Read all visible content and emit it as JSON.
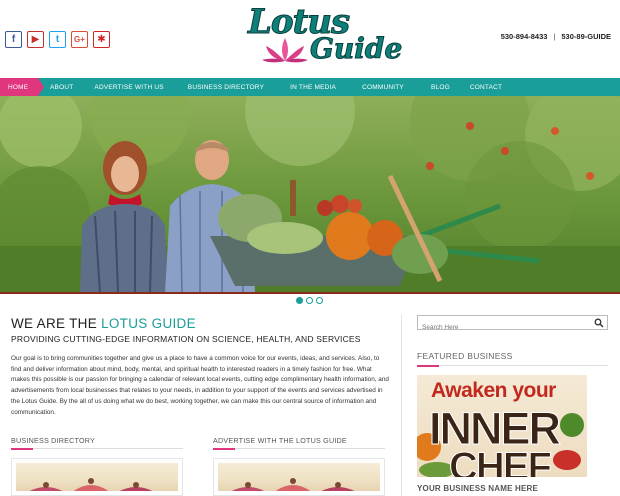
{
  "header": {
    "social": [
      {
        "name": "facebook",
        "glyph": "f"
      },
      {
        "name": "youtube",
        "glyph": "▶"
      },
      {
        "name": "twitter",
        "glyph": "t"
      },
      {
        "name": "google-plus",
        "glyph": "G+"
      },
      {
        "name": "yelp",
        "glyph": "✱"
      }
    ],
    "logo_word1": "Lotus",
    "logo_word2": "Guide",
    "phone_numeric": "530-894-8433",
    "phone_separator": "|",
    "phone_vanity": "530-89-GUIDE"
  },
  "nav": {
    "items": [
      {
        "label": "HOME",
        "active": true
      },
      {
        "label": "ABOUT"
      },
      {
        "label": "ADVERTISE WITH US"
      },
      {
        "label": "BUSINESS DIRECTORY"
      },
      {
        "label": "IN THE MEDIA"
      },
      {
        "label": "COMMUNITY"
      },
      {
        "label": "BLOG"
      },
      {
        "label": "CONTACT"
      }
    ],
    "active_color": "#e0367e",
    "bar_color": "#1a9e99"
  },
  "slider": {
    "dots": 3,
    "active_dot": 1
  },
  "main": {
    "title_prefix": "WE ARE THE ",
    "title_accent": "LOTUS GUIDE",
    "subtitle": "PROVIDING CUTTING-EDGE INFORMATION ON SCIENCE, HEALTH, AND SERVICES",
    "body": "Our goal is to bring communities together and give us a place to have a common voice for our events, ideas, and services. Also, to find and deliver information about mind, body, mental, and spiritual health to interested readers in a timely fashion for free. What makes this possible is our passion for bringing a calendar of relevant local events, cutting edge complimentary health information, and advertisements from local businesses that relates to your needs, in addition to your support of the events and services advertised in the Lotus Guide. By the all of us doing what we do best, working together, we can make this our central source of information and communication.",
    "columns": [
      {
        "heading": "BUSINESS DIRECTORY"
      },
      {
        "heading": "ADVERTISE WITH THE LOTUS GUIDE"
      }
    ]
  },
  "sidebar": {
    "search_placeholder": "Search Here",
    "featured_heading": "FEATURED BUSINESS",
    "featured_image_line1": "Awaken your",
    "featured_image_line2": "INNER",
    "featured_image_line3": "CHEF",
    "featured_caption": "YOUR BUSINESS NAME HERE"
  }
}
